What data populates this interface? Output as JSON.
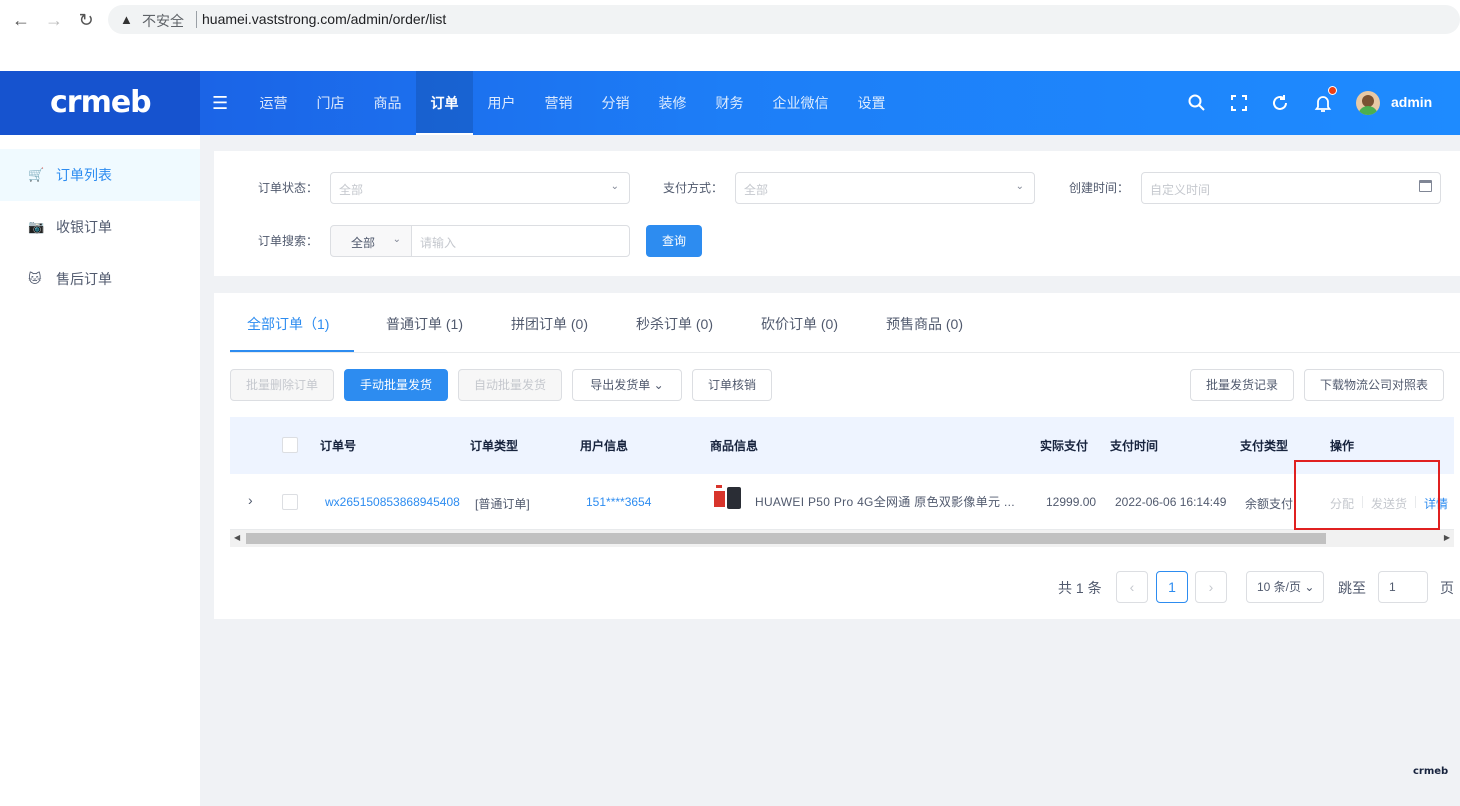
{
  "browser": {
    "insecure_label": "不安全",
    "url": "huamei.vaststrong.com/admin/order/list"
  },
  "header": {
    "logo": "crmeb",
    "nav": [
      "运营",
      "门店",
      "商品",
      "订单",
      "用户",
      "营销",
      "分销",
      "装修",
      "财务",
      "企业微信",
      "设置"
    ],
    "active_nav": "订单",
    "user": "admin"
  },
  "sidebar": {
    "items": [
      {
        "label": "订单列表",
        "icon": "cart-icon",
        "active": true
      },
      {
        "label": "收银订单",
        "icon": "cashier-icon",
        "active": false
      },
      {
        "label": "售后订单",
        "icon": "aftersale-icon",
        "active": false
      }
    ]
  },
  "filters": {
    "status_label": "订单状态：",
    "status_value": "全部",
    "pay_label": "支付方式：",
    "pay_value": "全部",
    "time_label": "创建时间：",
    "time_placeholder": "自定义时间",
    "search_label": "订单搜索：",
    "search_type": "全部",
    "search_placeholder": "请输入",
    "query_button": "查询"
  },
  "tabs": [
    "全部订单（1)",
    "普通订单 (1)",
    "拼团订单 (0)",
    "秒杀订单 (0)",
    "砍价订单 (0)",
    "预售商品 (0)"
  ],
  "toolbar": {
    "batch_delete": "批量删除订单",
    "manual_ship": "手动批量发货",
    "auto_ship": "自动批量发货",
    "export": "导出发货单",
    "verify": "订单核销",
    "ship_records": "批量发货记录",
    "download_logistics": "下载物流公司对照表"
  },
  "table": {
    "columns": [
      "订单号",
      "订单类型",
      "用户信息",
      "商品信息",
      "实际支付",
      "支付时间",
      "支付类型",
      "操作"
    ],
    "rows": [
      {
        "order_no": "wx265150853868945408",
        "type": "[普通订单]",
        "user": "151****3654",
        "product": "HUAWEI P50 Pro 4G全网通 原色双影像单元 ...",
        "paid": "12999.00",
        "pay_time": "2022-06-06 16:14:49",
        "pay_type": "余额支付",
        "actions": [
          "分配",
          "发送货",
          "详情"
        ]
      }
    ]
  },
  "pager": {
    "total": "共 1 条",
    "current": "1",
    "size": "10 条/页",
    "jump_label": "跳至",
    "jump_value": "1",
    "page_suffix": "页"
  },
  "colors": {
    "primary": "#2d8cf0",
    "header": "#1d7ef7",
    "highlight": "#e02020"
  }
}
